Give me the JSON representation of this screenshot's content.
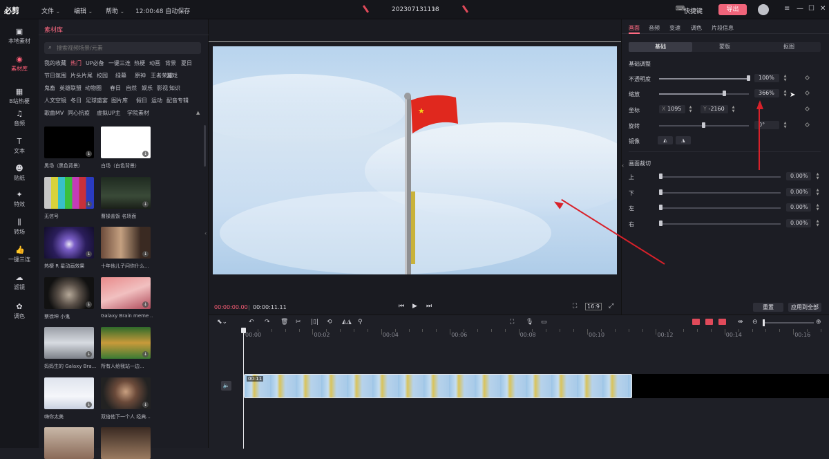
{
  "topbar": {
    "logo": "必剪",
    "menus": [
      "文件",
      "编辑",
      "帮助"
    ],
    "autosave": "12:00:48 自动保存",
    "project_name": "202307131118",
    "shortcut": "快捷键",
    "export": "导出",
    "window_controls": [
      "≡",
      "—",
      "☐",
      "✕"
    ]
  },
  "leftnav": {
    "items": [
      {
        "label": "本地素材",
        "icon": "folder-icon",
        "glyph": "▣"
      },
      {
        "label": "素材库",
        "icon": "library-icon",
        "glyph": "◉",
        "active": true
      },
      {
        "label": "B站热梗",
        "icon": "bilibili-icon",
        "glyph": "▦"
      },
      {
        "label": "音频",
        "icon": "music-icon",
        "glyph": "♫"
      },
      {
        "label": "文本",
        "icon": "text-icon",
        "glyph": "T"
      },
      {
        "label": "贴纸",
        "icon": "sticker-icon",
        "glyph": "☻"
      },
      {
        "label": "特效",
        "icon": "effect-icon",
        "glyph": "✦"
      },
      {
        "label": "转场",
        "icon": "transition-icon",
        "glyph": "⫼"
      },
      {
        "label": "一键三连",
        "icon": "like-icon",
        "glyph": "👍"
      },
      {
        "label": "滤镜",
        "icon": "filter-icon",
        "glyph": "☁"
      },
      {
        "label": "调色",
        "icon": "palette-icon",
        "glyph": "✿"
      }
    ]
  },
  "library": {
    "tab": "素材库",
    "search_placeholder": "搜索视频场景/元素",
    "tags": [
      [
        "我的收藏",
        "热门",
        "UP必备",
        "一键三连",
        "热梗",
        "动画",
        "背景",
        "夏日"
      ],
      [
        "节日氛围",
        "片头片尾",
        "校园",
        "绿幕",
        "原神",
        "王者荣耀",
        "游戏"
      ],
      [
        "鬼畜",
        "英雄联盟",
        "动物圈",
        "春日",
        "自然",
        "娱乐",
        "影视",
        "知识"
      ],
      [
        "人文空镜",
        "冬日",
        "足球盛宴",
        "图片库",
        "假日",
        "运动",
        "配音专辑"
      ],
      [
        "歌曲MV",
        "同心抗疫",
        "虚拟UP主",
        "学院素材"
      ]
    ],
    "active_tag": "热门",
    "thumbs": [
      {
        "label": "黑场（黑色背景）",
        "style": "black"
      },
      {
        "label": "白场（白色背景）",
        "style": "white"
      },
      {
        "label": "无信号",
        "style": "bars"
      },
      {
        "label": "曹操盖饭 名场面",
        "style": "dark-scene"
      },
      {
        "label": "热梗 R 星动画效果",
        "style": "rockstar"
      },
      {
        "label": "十年他儿子问你什么...",
        "style": "drama"
      },
      {
        "label": "蔡徐坤 小鬼",
        "style": "person-dark"
      },
      {
        "label": "Galaxy Brain meme ...",
        "style": "galaxy"
      },
      {
        "label": "妈妈生的 Galaxy Bra...",
        "style": "grey-meme"
      },
      {
        "label": "所有人给我站一边...",
        "style": "cartoon"
      },
      {
        "label": "嗨你太美",
        "style": "dance"
      },
      {
        "label": "双倍他下一个人 经典...",
        "style": "portrait"
      },
      {
        "label": "",
        "style": "person2"
      },
      {
        "label": "",
        "style": "person3"
      }
    ]
  },
  "preview": {
    "current_time": "00:00:00.00",
    "total_time": "00:00:11.11",
    "ratio": "16:9"
  },
  "props": {
    "tabs": [
      "画面",
      "音频",
      "变速",
      "调色",
      "片段信息"
    ],
    "active_tab": "画面",
    "segments": [
      "基础",
      "蒙版",
      "抠图"
    ],
    "section_basic": "基础调整",
    "opacity_label": "不透明度",
    "opacity_value": "100%",
    "opacity_level": 1.0,
    "scale_label": "缩放",
    "scale_value": "366%",
    "scale_level": 0.73,
    "position_label": "坐标",
    "x_prefix": "X",
    "x_value": "1095",
    "y_prefix": "Y",
    "y_value": "-2160",
    "rotate_label": "旋转",
    "rotate_value": "0°",
    "rotate_level": 0.5,
    "mirror_label": "镜像",
    "section_crop": "画面裁切",
    "crop": [
      {
        "label": "上",
        "value": "0.00%"
      },
      {
        "label": "下",
        "value": "0.00%"
      },
      {
        "label": "左",
        "value": "0.00%"
      },
      {
        "label": "右",
        "value": "0.00%"
      }
    ],
    "reset": "重置",
    "apply_all": "应用到全部"
  },
  "timeline": {
    "ruler": [
      "00:00",
      "00:02",
      "00:04",
      "00:06",
      "00:08",
      "00:10",
      "00:12",
      "00:14",
      "00:16"
    ],
    "clip_duration": "00:11"
  },
  "colors": {
    "accent": "#ff5f78",
    "annotation_arrow": "#d8212a",
    "flag_red": "#e0281e",
    "flag_star": "#f5d31a"
  }
}
